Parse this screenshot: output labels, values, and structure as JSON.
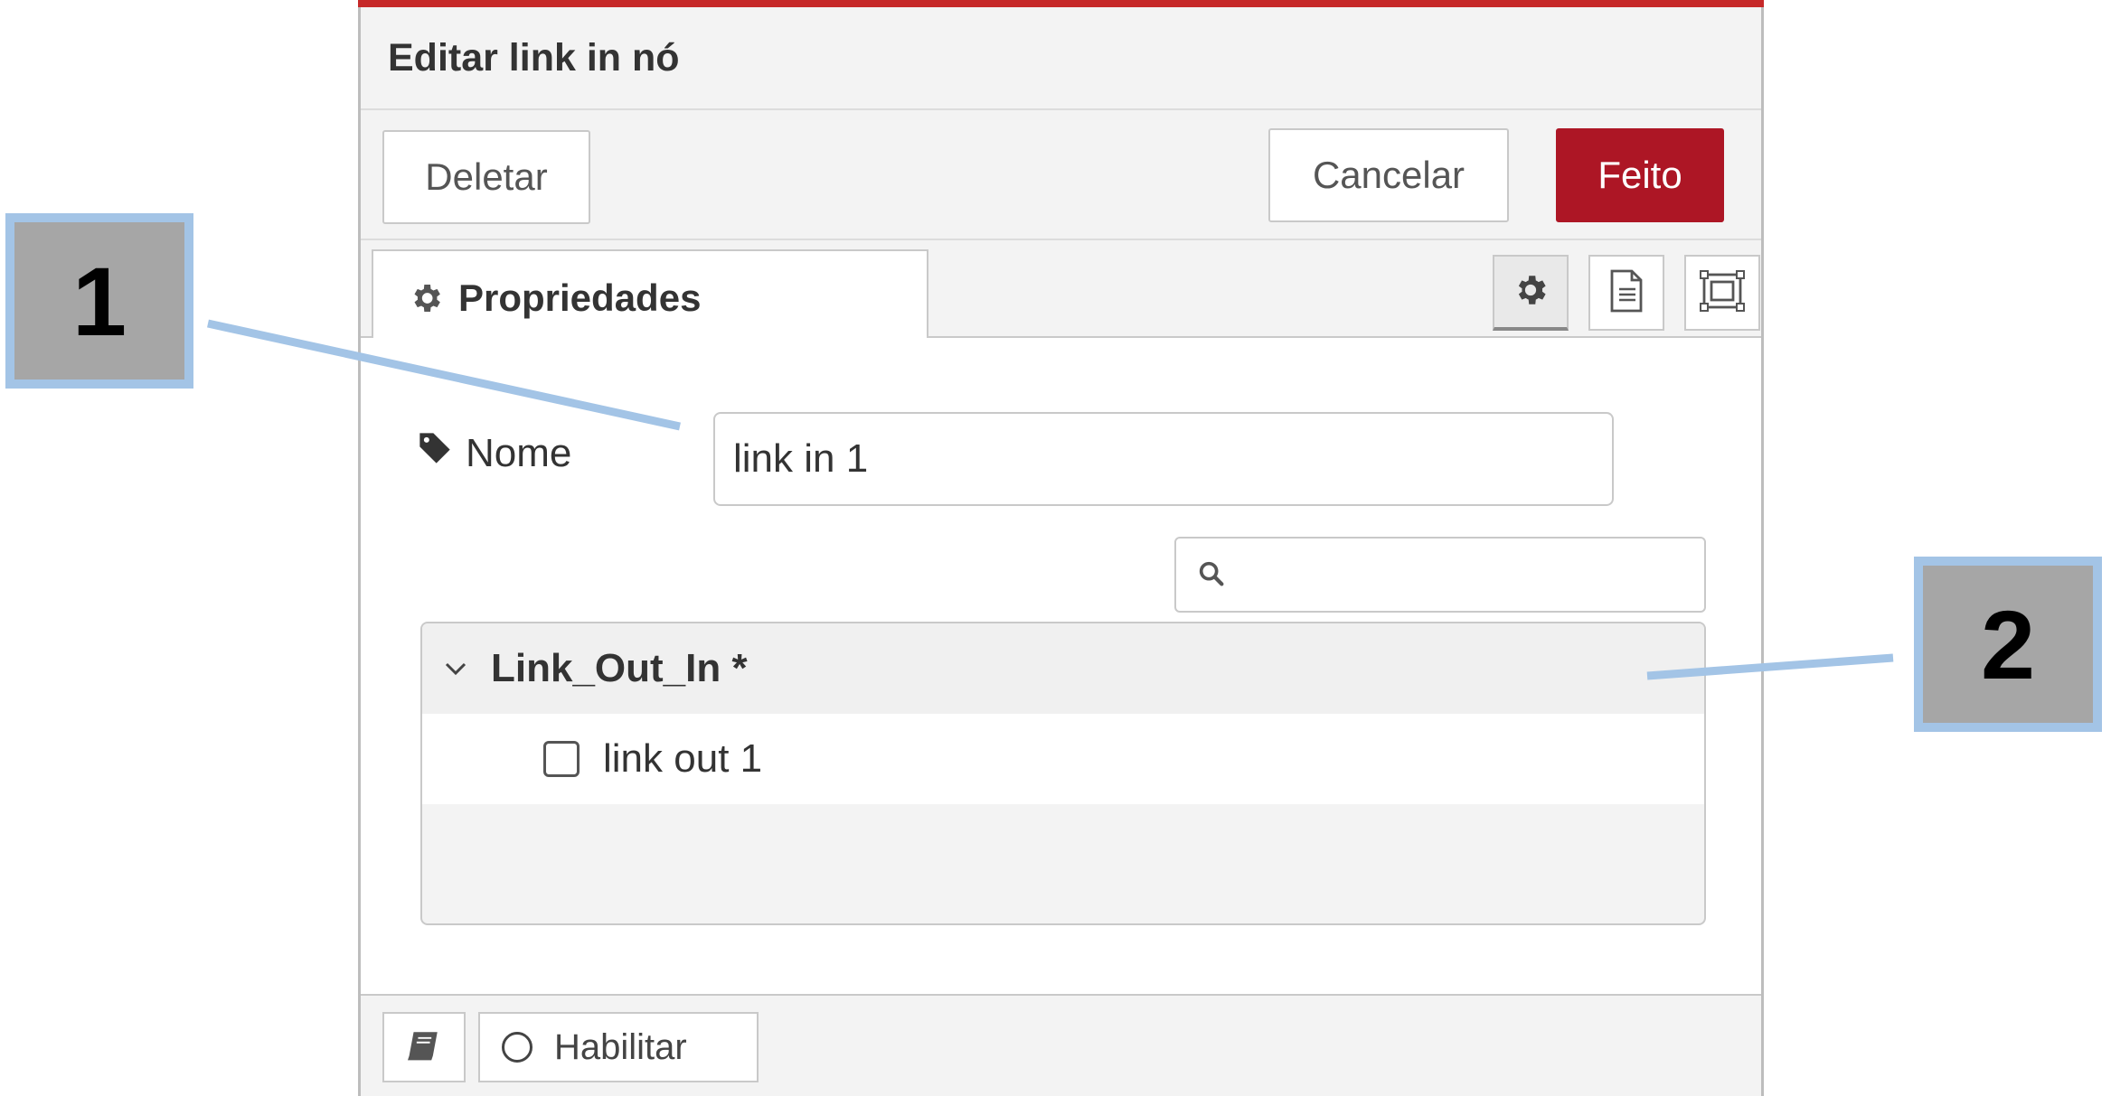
{
  "dialog": {
    "title": "Editar link in nó",
    "buttons": {
      "delete": "Deletar",
      "cancel": "Cancelar",
      "done": "Feito"
    },
    "tab": {
      "label": "Propriedades"
    },
    "tab_icons": [
      "gear-icon",
      "document-icon",
      "frame-icon"
    ],
    "name_field": {
      "label": "Nome",
      "value": "link in 1"
    },
    "search": {
      "placeholder": ""
    },
    "tree": {
      "flow_label": "Link_Out_In *",
      "nodes": [
        {
          "label": "link out 1",
          "checked": false
        }
      ]
    },
    "footer": {
      "enable_label": "Habilitar"
    }
  },
  "annotations": {
    "callout_1": "1",
    "callout_2": "2"
  },
  "colors": {
    "accent": "#ad1625",
    "topbar": "#c62828",
    "callout_border": "#a3c4e6",
    "callout_fill": "#a6a6a6"
  }
}
